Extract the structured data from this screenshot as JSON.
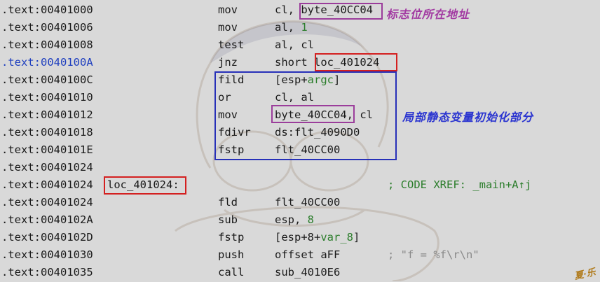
{
  "rows": [
    {
      "addr": ".text:00401000",
      "label": "",
      "mnemonic": "mov",
      "operand_parts": [
        {
          "t": "cl, "
        },
        {
          "t": "byte_40CC04"
        }
      ],
      "comment": ""
    },
    {
      "addr": ".text:00401006",
      "label": "",
      "mnemonic": "mov",
      "operand_parts": [
        {
          "t": "al, "
        },
        {
          "t": "1",
          "cls": "num"
        }
      ],
      "comment": ""
    },
    {
      "addr": ".text:00401008",
      "label": "",
      "mnemonic": "test",
      "operand_parts": [
        {
          "t": "al, cl"
        }
      ],
      "comment": ""
    },
    {
      "addr": ".text:0040100A",
      "label": "",
      "mnemonic": "jnz",
      "operand_parts": [
        {
          "t": "short "
        },
        {
          "t": "loc_401024"
        }
      ],
      "comment": "",
      "highlight": true
    },
    {
      "addr": ".text:0040100C",
      "label": "",
      "mnemonic": "fild",
      "operand_parts": [
        {
          "t": "[esp+"
        },
        {
          "t": "argc",
          "cls": "num"
        },
        {
          "t": "]"
        }
      ],
      "comment": ""
    },
    {
      "addr": ".text:00401010",
      "label": "",
      "mnemonic": "or",
      "operand_parts": [
        {
          "t": "cl, al"
        }
      ],
      "comment": ""
    },
    {
      "addr": ".text:00401012",
      "label": "",
      "mnemonic": "mov",
      "operand_parts": [
        {
          "t": "byte_40CC04"
        },
        {
          "t": ", cl"
        }
      ],
      "comment": ""
    },
    {
      "addr": ".text:00401018",
      "label": "",
      "mnemonic": "fdivr",
      "operand_parts": [
        {
          "t": "ds:flt_4090D0"
        }
      ],
      "comment": ""
    },
    {
      "addr": ".text:0040101E",
      "label": "",
      "mnemonic": "fstp",
      "operand_parts": [
        {
          "t": "flt_40CC00"
        }
      ],
      "comment": ""
    },
    {
      "addr": ".text:00401024",
      "label": "",
      "mnemonic": "",
      "operand_parts": [],
      "comment": ""
    },
    {
      "addr": ".text:00401024",
      "label": "loc_401024:",
      "mnemonic": "",
      "operand_parts": [],
      "comment": "; CODE XREF: _main+A↑j"
    },
    {
      "addr": ".text:00401024",
      "label": "",
      "mnemonic": "fld",
      "operand_parts": [
        {
          "t": "flt_40CC00"
        }
      ],
      "comment": ""
    },
    {
      "addr": ".text:0040102A",
      "label": "",
      "mnemonic": "sub",
      "operand_parts": [
        {
          "t": "esp, "
        },
        {
          "t": "8",
          "cls": "num"
        }
      ],
      "comment": ""
    },
    {
      "addr": ".text:0040102D",
      "label": "",
      "mnemonic": "fstp",
      "operand_parts": [
        {
          "t": "[esp+8+"
        },
        {
          "t": "var_8",
          "cls": "num"
        },
        {
          "t": "]"
        }
      ],
      "comment": ""
    },
    {
      "addr": ".text:00401030",
      "label": "",
      "mnemonic": "push",
      "operand_parts": [
        {
          "t": "offset aFF"
        }
      ],
      "comment": "; \"f = %f\\r\\n\"",
      "comment_gray": true
    },
    {
      "addr": ".text:00401035",
      "label": "",
      "mnemonic": "call",
      "operand_parts": [
        {
          "t": "sub_4010E6"
        }
      ],
      "comment": ""
    }
  ],
  "annotations": {
    "flag_address": "标志位所在地址",
    "static_init": "局部静态变量初始化部分"
  },
  "colors": {
    "purple": "#9b3d9b",
    "red": "#d42020",
    "blue": "#2730b8",
    "green": "#2b7d2b"
  }
}
